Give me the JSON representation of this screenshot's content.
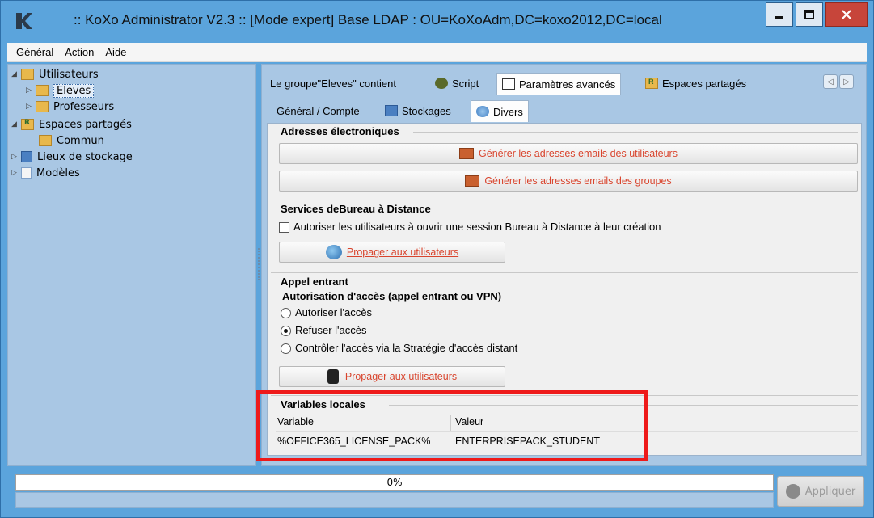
{
  "window": {
    "title": ":: KoXo Administrator V2.3 :: [Mode expert] Base LDAP : OU=KoXoAdm,DC=koxo2012,DC=local",
    "minimize_label": "_",
    "maximize_label": "☐",
    "close_label": "x"
  },
  "menu": [
    "Général",
    "Action",
    "Aide"
  ],
  "tree": {
    "utilisateurs": "Utilisateurs",
    "eleves": "Eleves",
    "professeurs": "Professeurs",
    "espaces_partages": "Espaces partagés",
    "commun": "Commun",
    "lieux_stockage": "Lieux de stockage",
    "modeles": "Modèles"
  },
  "top_tabs": {
    "contient": "Le groupe\"Eleves\" contient",
    "script": "Script",
    "parametres": "Paramètres avancés",
    "espaces": "Espaces partagés"
  },
  "inner_tabs": {
    "general": "Général / Compte",
    "stockages": "Stockages",
    "divers": "Divers"
  },
  "adresses": {
    "title": "Adresses électroniques",
    "btn_users": "Générer les adresses emails des utilisateurs",
    "btn_groups": "Générer les adresses emails des groupes"
  },
  "bureau": {
    "title": "Services deBureau à Distance",
    "checkbox_label": "Autoriser les utilisateurs à ouvrir une session Bureau à Distance à leur création",
    "checkbox_checked": false,
    "propagate": "Propager aux utilisateurs"
  },
  "appel": {
    "title": "Appel entrant",
    "subtitle": "Autorisation d'accès (appel entrant ou VPN)",
    "options": [
      "Autoriser l'accès",
      "Refuser l'accès",
      "Contrôler l'accès via la Stratégie d'accès distant"
    ],
    "selected": 1,
    "propagate": "Propager aux utilisateurs"
  },
  "variables": {
    "title": "Variables locales",
    "col_variable": "Variable",
    "col_valeur": "Valeur",
    "rows": [
      {
        "variable": "%OFFICE365_LICENSE_PACK%",
        "valeur": "ENTERPRISEPACK_STUDENT"
      }
    ]
  },
  "progress": {
    "label": "0%",
    "value": 0
  },
  "apply_label": "Appliquer",
  "colors": {
    "titlebar": "#5ba4dc",
    "panel": "#a9c7e4",
    "link_red": "#d9452e",
    "highlight": "#ee1a1a"
  }
}
